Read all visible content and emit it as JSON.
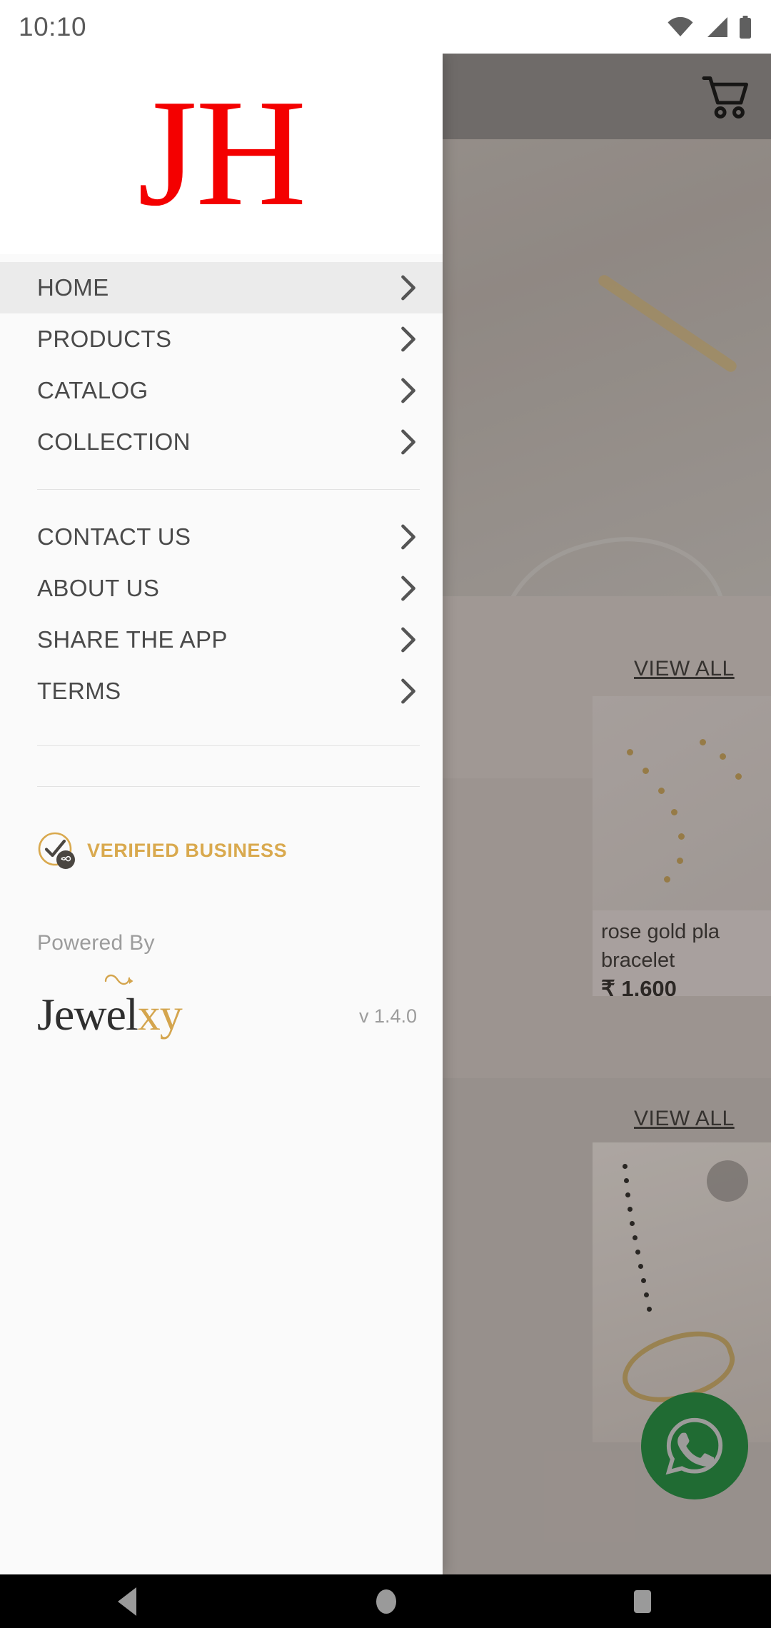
{
  "status_bar": {
    "time": "10:10",
    "icons": [
      "wifi-icon",
      "signal-icon",
      "battery-icon"
    ]
  },
  "drawer": {
    "logo_text": "JH",
    "logo_color": "#f40000",
    "menu_groups": [
      {
        "items": [
          {
            "label": "HOME",
            "active": true,
            "chevron": "chevron-right-icon"
          },
          {
            "label": "PRODUCTS",
            "active": false,
            "chevron": "chevron-right-icon"
          },
          {
            "label": "CATALOG",
            "active": false,
            "chevron": "chevron-right-icon"
          },
          {
            "label": "COLLECTION",
            "active": false,
            "chevron": "chevron-right-icon"
          }
        ]
      },
      {
        "items": [
          {
            "label": "CONTACT US",
            "active": false,
            "chevron": "chevron-right-icon"
          },
          {
            "label": "ABOUT US",
            "active": false,
            "chevron": "chevron-right-icon"
          },
          {
            "label": "SHARE THE APP",
            "active": false,
            "chevron": "chevron-right-icon"
          },
          {
            "label": "TERMS",
            "active": false,
            "chevron": "chevron-right-icon"
          }
        ]
      }
    ],
    "verified": {
      "label": "VERIFIED BUSINESS",
      "color": "#d9a94e",
      "icon": "verified-check-infinity-icon"
    },
    "footer": {
      "powered_by": "Powered By",
      "brand_dark": "Jewel",
      "brand_accent": "xy",
      "brand_accent_color": "#d4a54e",
      "version": "v 1.4.0"
    }
  },
  "background_app": {
    "cart_icon": "shopping-cart-icon",
    "view_all_1": "VIEW ALL",
    "view_all_2": "VIEW ALL",
    "product": {
      "title": "rose gold pla",
      "title_line2": "bracelet",
      "price": "₹ 1,600"
    },
    "whatsapp_fab": {
      "icon": "whatsapp-icon",
      "color": "#1d8a3c"
    }
  },
  "nav_bar": {
    "back": "back-triangle-icon",
    "home": "home-circle-icon",
    "recents": "recents-square-icon"
  }
}
